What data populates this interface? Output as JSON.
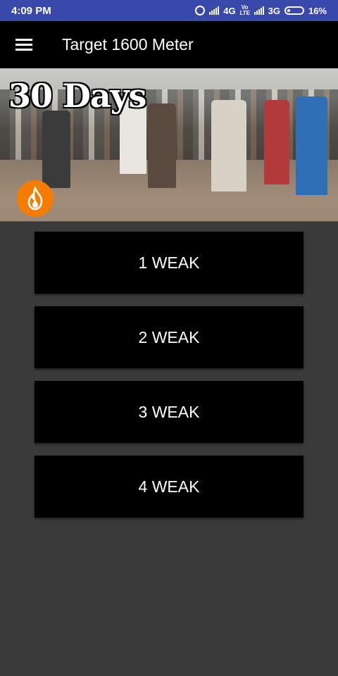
{
  "status_bar": {
    "time": "4:09 PM",
    "net1": "4G",
    "volte": "Vo LTE",
    "net2": "3G",
    "battery": "16%"
  },
  "app_bar": {
    "title": "Target 1600 Meter",
    "menu_icon": "hamburger-menu-icon"
  },
  "banner": {
    "title": "30 Days",
    "badge_icon": "fire-icon",
    "badge_color": "#f57c00"
  },
  "weeks": [
    {
      "label": "1 WEAK"
    },
    {
      "label": "2 WEAK"
    },
    {
      "label": "3 WEAK"
    },
    {
      "label": "4 WEAK"
    }
  ],
  "colors": {
    "status_bar": "#3949ab",
    "app_bar": "#000000",
    "background": "#3a3a3a",
    "button": "#000000"
  }
}
